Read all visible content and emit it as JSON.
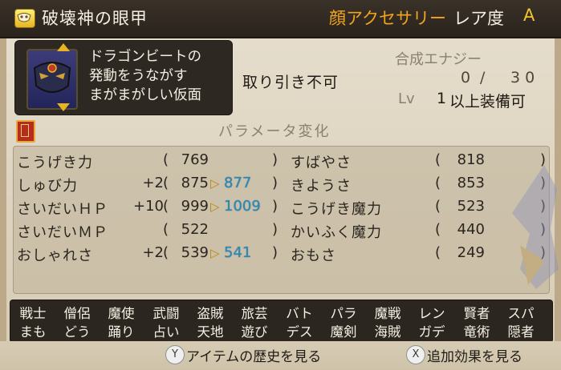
{
  "header": {
    "item_name": "破壊神の眼甲",
    "slot_type": "顔アクセサリー",
    "rarity_label": "レア度",
    "rarity_value": "A"
  },
  "description": {
    "lines": [
      "ドラゴンビートの",
      "発動をうながす",
      "まがまがしい仮面"
    ]
  },
  "tradable": "取り引き不可",
  "synthesis": {
    "label": "合成エナジー",
    "current": "0",
    "slash": "/",
    "max": "30"
  },
  "level": {
    "label": "Lv",
    "value": "1",
    "suffix": "以上装備可"
  },
  "params_title": "パラメータ変化",
  "stats_left": [
    {
      "name": "こうげき力",
      "bonus": "",
      "base": "769",
      "new": ""
    },
    {
      "name": "しゅび力",
      "bonus": "+2",
      "base": "875",
      "new": "877"
    },
    {
      "name": "さいだいＨＰ",
      "bonus": "+10",
      "base": "999",
      "new": "1009"
    },
    {
      "name": "さいだいＭＰ",
      "bonus": "",
      "base": "522",
      "new": ""
    },
    {
      "name": "おしゃれさ",
      "bonus": "+2",
      "base": "539",
      "new": "541"
    }
  ],
  "stats_right": [
    {
      "name": "すばやさ",
      "value": "818"
    },
    {
      "name": "きようさ",
      "value": "853"
    },
    {
      "name": "こうげき魔力",
      "value": "523"
    },
    {
      "name": "かいふく魔力",
      "value": "440"
    },
    {
      "name": "おもさ",
      "value": "249"
    }
  ],
  "paren_open": "(",
  "paren_close": ")",
  "arrow_glyph": "▷",
  "jobs_row1": [
    "戦士",
    "僧侶",
    "魔使",
    "武闘",
    "盗賊",
    "旅芸",
    "バト",
    "パラ",
    "魔戦",
    "レン",
    "賢者",
    "スパ"
  ],
  "jobs_row2": [
    "まも",
    "どう",
    "踊り",
    "占い",
    "天地",
    "遊び",
    "デス",
    "魔剣",
    "海賊",
    "ガデ",
    "竜術",
    "隠者"
  ],
  "footer": {
    "y_button": "Y",
    "history_label": "アイテムの歴史を見る",
    "x_button": "X",
    "effects_label": "追加効果を見る"
  },
  "colors": {
    "header_bg": "#2a231c",
    "slot_type": "#f0a51e",
    "rarity": "#f3c42c",
    "new_value": "#2b8ab8",
    "parchment": "#ddd3bf"
  },
  "icons": {
    "item_category": "mask-icon",
    "book": "book-icon"
  }
}
